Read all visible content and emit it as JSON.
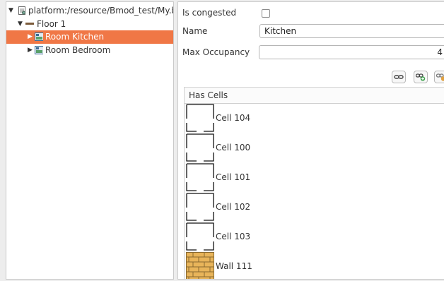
{
  "tree": {
    "root": {
      "label": "platform:/resource/Bmod_test/My.bm"
    },
    "floor": {
      "label": "Floor 1"
    },
    "rooms": [
      {
        "label": "Room Kitchen",
        "selected": true
      },
      {
        "label": "Room Bedroom",
        "selected": false
      }
    ]
  },
  "properties": {
    "is_congested": {
      "label": "Is congested",
      "checked": false
    },
    "name": {
      "label": "Name",
      "value": "Kitchen"
    },
    "max_occupancy": {
      "label": "Max Occupancy",
      "value": "4"
    }
  },
  "toolbar": {
    "buttons": [
      {
        "icon": "link-icon"
      },
      {
        "icon": "add-link-icon"
      },
      {
        "icon": "remove-link-icon"
      }
    ]
  },
  "has_cells": {
    "header": "Has Cells",
    "items": [
      {
        "label": "Cell 104",
        "icon": "cell-icon"
      },
      {
        "label": "Cell 100",
        "icon": "cell-icon"
      },
      {
        "label": "Cell 101",
        "icon": "cell-icon"
      },
      {
        "label": "Cell 102",
        "icon": "cell-icon"
      },
      {
        "label": "Cell 103",
        "icon": "cell-icon"
      },
      {
        "label": "Wall 111",
        "icon": "wall-icon"
      }
    ]
  },
  "colors": {
    "selection": "#f07746",
    "floor_bar": "#7a5a3a",
    "wall_brick": "#e8b45a"
  }
}
